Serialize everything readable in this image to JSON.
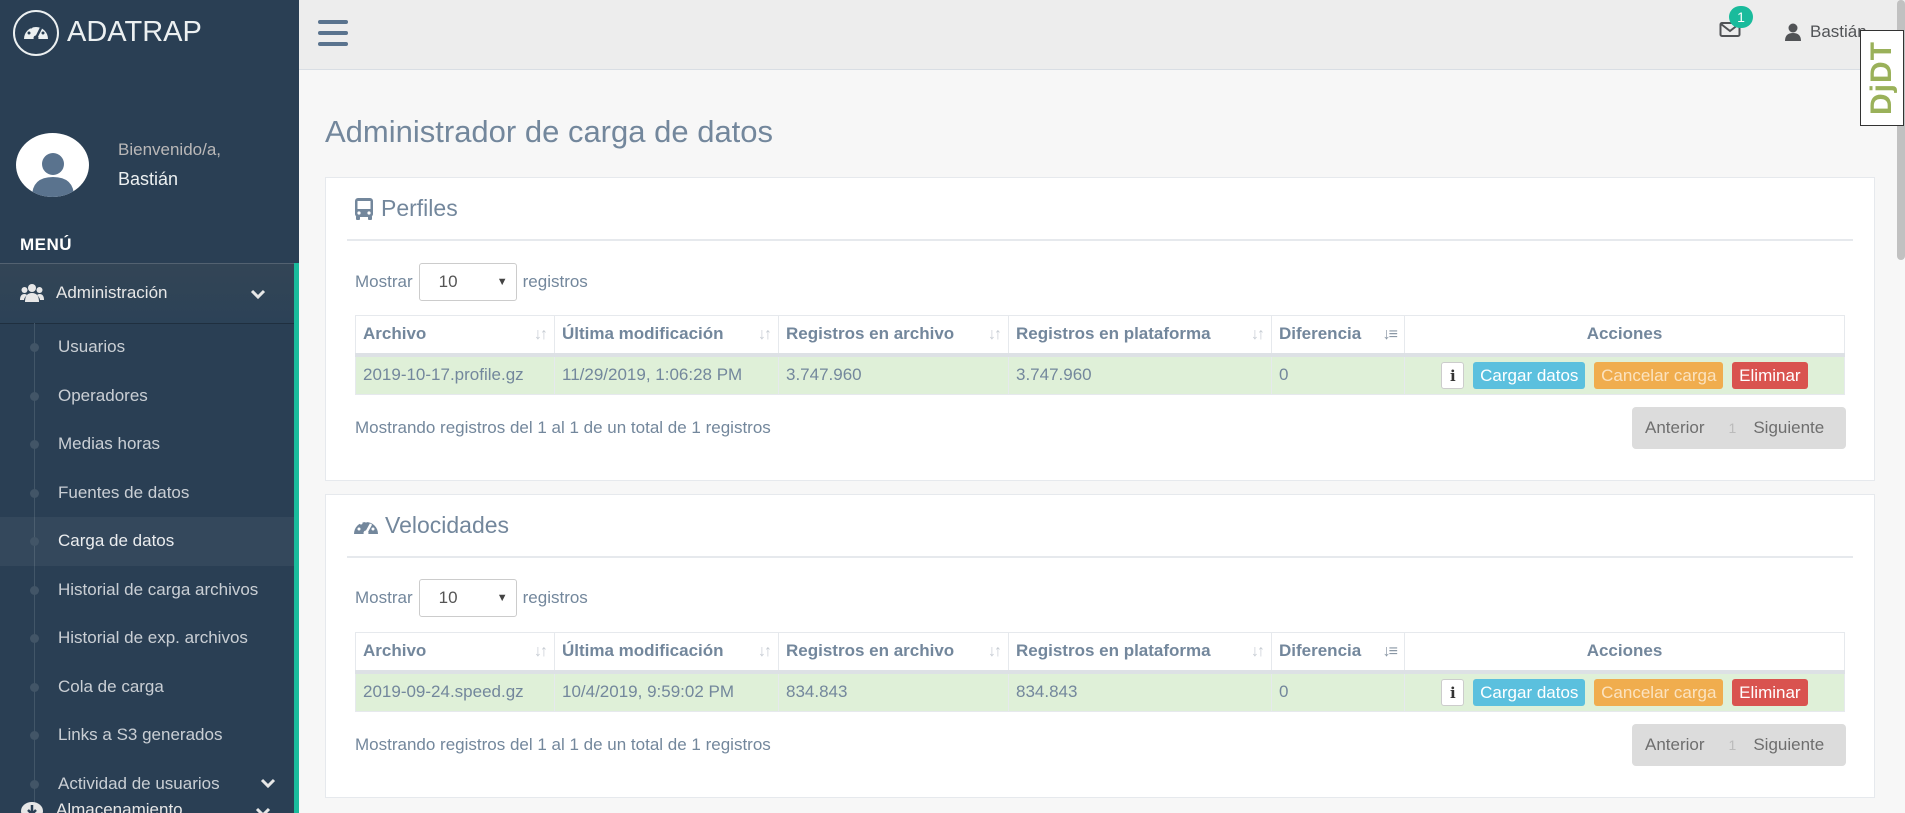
{
  "app": {
    "brand": "ADATRAP"
  },
  "profile": {
    "greeting": "Bienvenido/a,",
    "name": "Bastián"
  },
  "menu": {
    "title": "MENÚ",
    "admin_label": "Administración",
    "items": [
      {
        "label": "Usuarios"
      },
      {
        "label": "Operadores"
      },
      {
        "label": "Medias horas"
      },
      {
        "label": "Fuentes de datos"
      },
      {
        "label": "Carga de datos"
      },
      {
        "label": "Historial de carga archivos"
      },
      {
        "label": "Historial de exp. archivos"
      },
      {
        "label": "Cola de carga"
      },
      {
        "label": "Links a S3 generados"
      },
      {
        "label": "Actividad de usuarios"
      }
    ],
    "active_item": "Carga de datos",
    "storage_label": "Almacenamiento"
  },
  "topbar": {
    "notifications": "1",
    "user": "Bastián",
    "badge_logo": "DjDT"
  },
  "page": {
    "title": "Administrador de carga de datos"
  },
  "columns": [
    "Archivo",
    "Última modificación",
    "Registros en archivo",
    "Registros en plataforma",
    "Diferencia",
    "Acciones"
  ],
  "controls": {
    "show_label": "Mostrar",
    "show_value": "10",
    "records_label": "registros",
    "btn_load": "Cargar datos",
    "btn_cancel": "Cancelar carga",
    "btn_delete": "Eliminar",
    "info_icon": "i",
    "prev": "Anterior",
    "page": "1",
    "next": "Siguiente"
  },
  "panels": [
    {
      "title": "Perfiles",
      "row": {
        "file": "2019-10-17.profile.gz",
        "modified": "11/29/2019, 1:06:28 PM",
        "in_file": "3.747.960",
        "in_platform": "3.747.960",
        "diff": "0"
      },
      "summary": "Mostrando registros del 1 al 1 de un total de 1 registros"
    },
    {
      "title": "Velocidades",
      "row": {
        "file": "2019-09-24.speed.gz",
        "modified": "10/4/2019, 9:59:02 PM",
        "in_file": "834.843",
        "in_platform": "834.843",
        "diff": "0"
      },
      "summary": "Mostrando registros del 1 al 1 de un total de 1 registros"
    }
  ],
  "colors": {
    "sidebar": "#2a3f54",
    "accent": "#1abb9c",
    "row_success": "#dff0d8",
    "btn_info": "#5bc0de",
    "btn_warning": "#f0ad4e",
    "btn_danger": "#d9534f"
  }
}
